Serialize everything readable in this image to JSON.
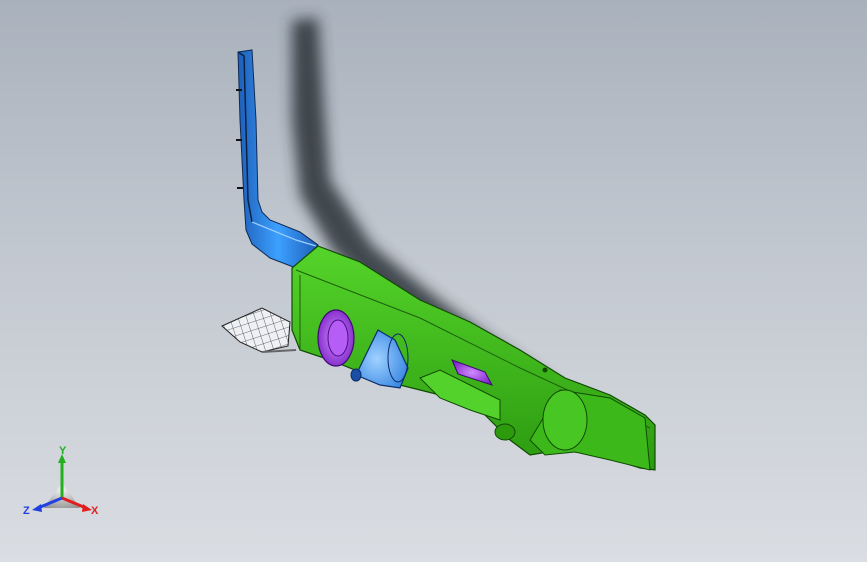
{
  "view": {
    "background_top": "#a9b1bc",
    "background_bottom": "#dadde2"
  },
  "model": {
    "colors": {
      "body": "#3fbe1a",
      "body_dark": "#248c0c",
      "duct": "#2f8fee",
      "duct_dark": "#1d5fb8",
      "vent": "#a23ef0",
      "vent_dark": "#6a18b0",
      "shadow": "#3c4048",
      "mesh": "#e8eaee"
    }
  },
  "triad": {
    "x_label": "X",
    "y_label": "Y",
    "z_label": "Z",
    "x_color": "#e02020",
    "y_color": "#20b020",
    "z_color": "#2040e0"
  }
}
